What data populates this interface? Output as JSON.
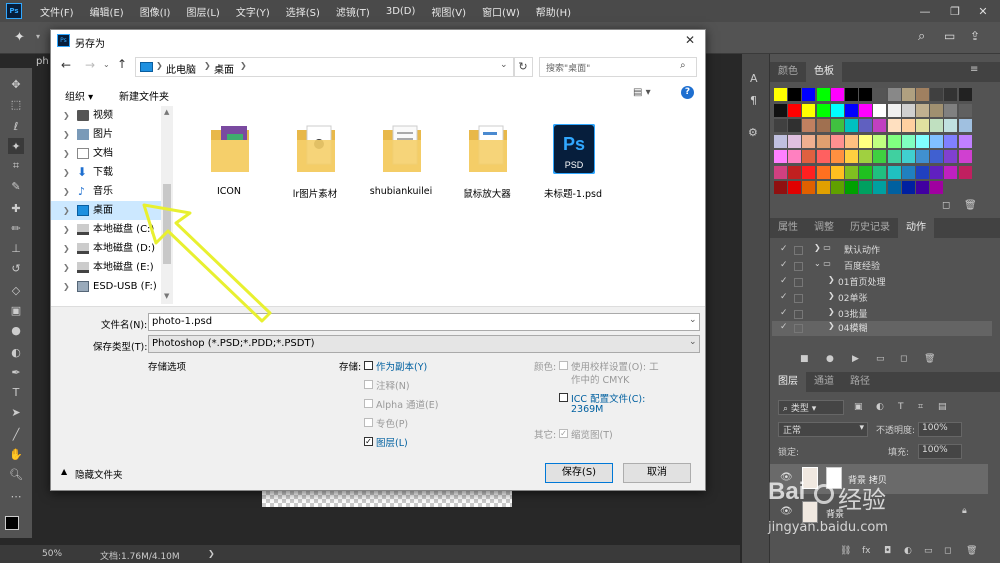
{
  "menu": {
    "items": [
      "文件(F)",
      "编辑(E)",
      "图像(I)",
      "图层(L)",
      "文字(Y)",
      "选择(S)",
      "滤镜(T)",
      "3D(D)",
      "视图(V)",
      "窗口(W)",
      "帮助(H)"
    ]
  },
  "status": {
    "zoom": "50%",
    "doc": "文档:1.76M/4.10M"
  },
  "tab_partial": "ph",
  "swatch_panel": {
    "tabs": [
      "颜色",
      "色板"
    ]
  },
  "swatches": [
    "#ffff00",
    "#000000",
    "#0000ff",
    "#00ff00",
    "#ff00ff",
    "#000000",
    "#000000",
    "#555555",
    "#888888",
    "#b0a080",
    "#a08060",
    "#404040",
    "#333333",
    "#222222",
    "#111111",
    "#ff0000",
    "#ffff00",
    "#00ff00",
    "#00ffff",
    "#0000ff",
    "#ff00ff",
    "#ffffff",
    "#f0f0f0",
    "#d0d0d0",
    "#c0b090",
    "#a09070",
    "#808080",
    "#606060",
    "#404040",
    "#303030",
    "#c08060",
    "#a07050",
    "#40c040",
    "#00c0c0",
    "#6060c0",
    "#c040c0",
    "#ffe0c0",
    "#ffd0a0",
    "#e0e0a0",
    "#c0e0c0",
    "#c0e0e0",
    "#a0c0e0",
    "#c0c0e0",
    "#e0c0e0",
    "#f0b090",
    "#e0a070",
    "#ff9090",
    "#ffc080",
    "#ffff80",
    "#c0ff80",
    "#80ff80",
    "#80ffc0",
    "#80ffff",
    "#80c0ff",
    "#8080ff",
    "#c080ff",
    "#ff80ff",
    "#ff80c0",
    "#e06040",
    "#ff6060",
    "#ff9040",
    "#ffd040",
    "#a0d040",
    "#40d040",
    "#40d0a0",
    "#40d0d0",
    "#4090d0",
    "#4060d0",
    "#8040d0",
    "#d040d0",
    "#d04080",
    "#c02020",
    "#ff2020",
    "#ff7020",
    "#ffc020",
    "#80c020",
    "#20c020",
    "#20c080",
    "#20c0c0",
    "#2080c0",
    "#2040c0",
    "#6020c0",
    "#c020c0",
    "#c02060",
    "#901010",
    "#e00000",
    "#e06000",
    "#e0a000",
    "#60a000",
    "#00a000",
    "#00a060",
    "#00a0a0",
    "#0060a0",
    "#0020a0",
    "#4000a0",
    "#a000a0"
  ],
  "actions_panel": {
    "tabs": [
      "属性",
      "调整",
      "历史记录",
      "动作"
    ],
    "rows": [
      "默认动作",
      "百度经验",
      "01首页处理",
      "02单张",
      "03批量",
      "04模糊"
    ]
  },
  "layers_panel": {
    "tabs": [
      "图层",
      "通道",
      "路径"
    ],
    "kind": "类型",
    "blend": "正常",
    "opacity_label": "不透明度:",
    "opacity": "100%",
    "lock_label": "锁定:",
    "fill_label": "填充:",
    "fill": "100%",
    "layer1": "背景 拷贝",
    "layer0": "背景"
  },
  "dialog": {
    "title": "另存为",
    "address": [
      "此电脑",
      "桌面"
    ],
    "search_placeholder": "搜索\"桌面\"",
    "organize": "组织 ▾",
    "new_folder": "新建文件夹",
    "tree": [
      "视频",
      "图片",
      "文档",
      "下载",
      "音乐",
      "桌面",
      "本地磁盘 (C:)",
      "本地磁盘 (D:)",
      "本地磁盘 (E:)",
      "ESD-USB (F:)"
    ],
    "files": [
      "ICON",
      "lr图片素材",
      "shubiankuilei",
      "鼠标放大器",
      "未标题-1.psd"
    ],
    "filename_label": "文件名(N):",
    "filename": "photo-1.psd",
    "type_label": "保存类型(T):",
    "type": "Photoshop (*.PSD;*.PDD;*.PSDT)",
    "options_title": "存储选项",
    "save_label": "存储:",
    "opts": [
      "作为副本(Y)",
      "注释(N)",
      "Alpha 通道(E)",
      "专色(P)",
      "图层(L)"
    ],
    "color_label": "颜色:",
    "proof_1": "使用校样设置(O): 工",
    "proof_2": "作中的 CMYK",
    "icc_1": "ICC 配置文件(C):",
    "icc_2": "2369M",
    "other_label": "其它:",
    "thumb": "缩览图(T)",
    "hide_folders": "隐藏文件夹",
    "save_btn": "保存(S)",
    "cancel_btn": "取消"
  },
  "watermark": {
    "brand": "Bai",
    "text": "经验",
    "url": "jingyan.baidu.com"
  }
}
